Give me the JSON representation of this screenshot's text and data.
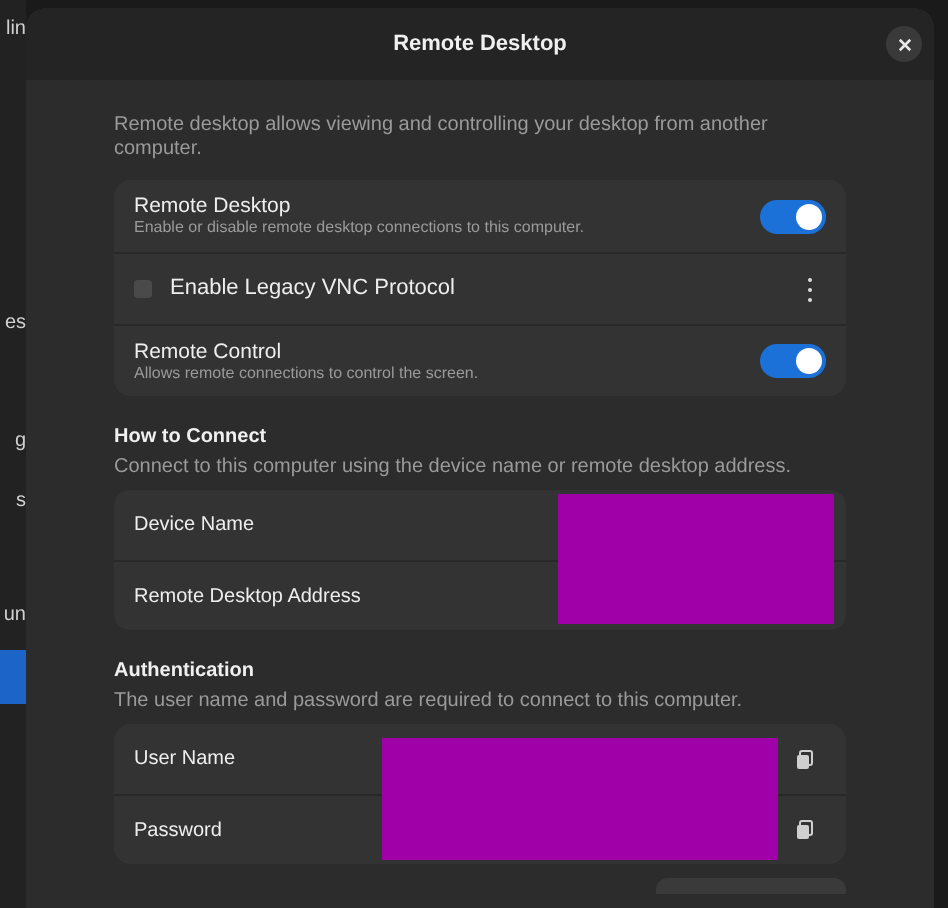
{
  "background_window": {
    "fragments": [
      "lin",
      "es",
      "g",
      "s",
      "un"
    ]
  },
  "dialog": {
    "title": "Remote Desktop",
    "intro": "Remote desktop allows viewing and controlling your desktop from another computer.",
    "settings": [
      {
        "kind": "switch",
        "title": "Remote Desktop",
        "subtitle": "Enable or disable remote desktop connections to this computer.",
        "on": true
      },
      {
        "kind": "checkbox",
        "title": "Enable Legacy VNC Protocol",
        "checked": false
      },
      {
        "kind": "switch",
        "title": "Remote Control",
        "subtitle": "Allows remote connections to control the screen.",
        "on": true
      }
    ],
    "sections": [
      {
        "heading": "How to Connect",
        "description": "Connect to this computer using the device name or remote desktop address.",
        "redacted": true,
        "copy_buttons": false,
        "rows": [
          "Device Name",
          "Remote Desktop Address"
        ]
      },
      {
        "heading": "Authentication",
        "description": "The user name and password are required to connect to this computer.",
        "redacted": true,
        "copy_buttons": true,
        "rows": [
          "User Name",
          "Password"
        ]
      }
    ]
  }
}
